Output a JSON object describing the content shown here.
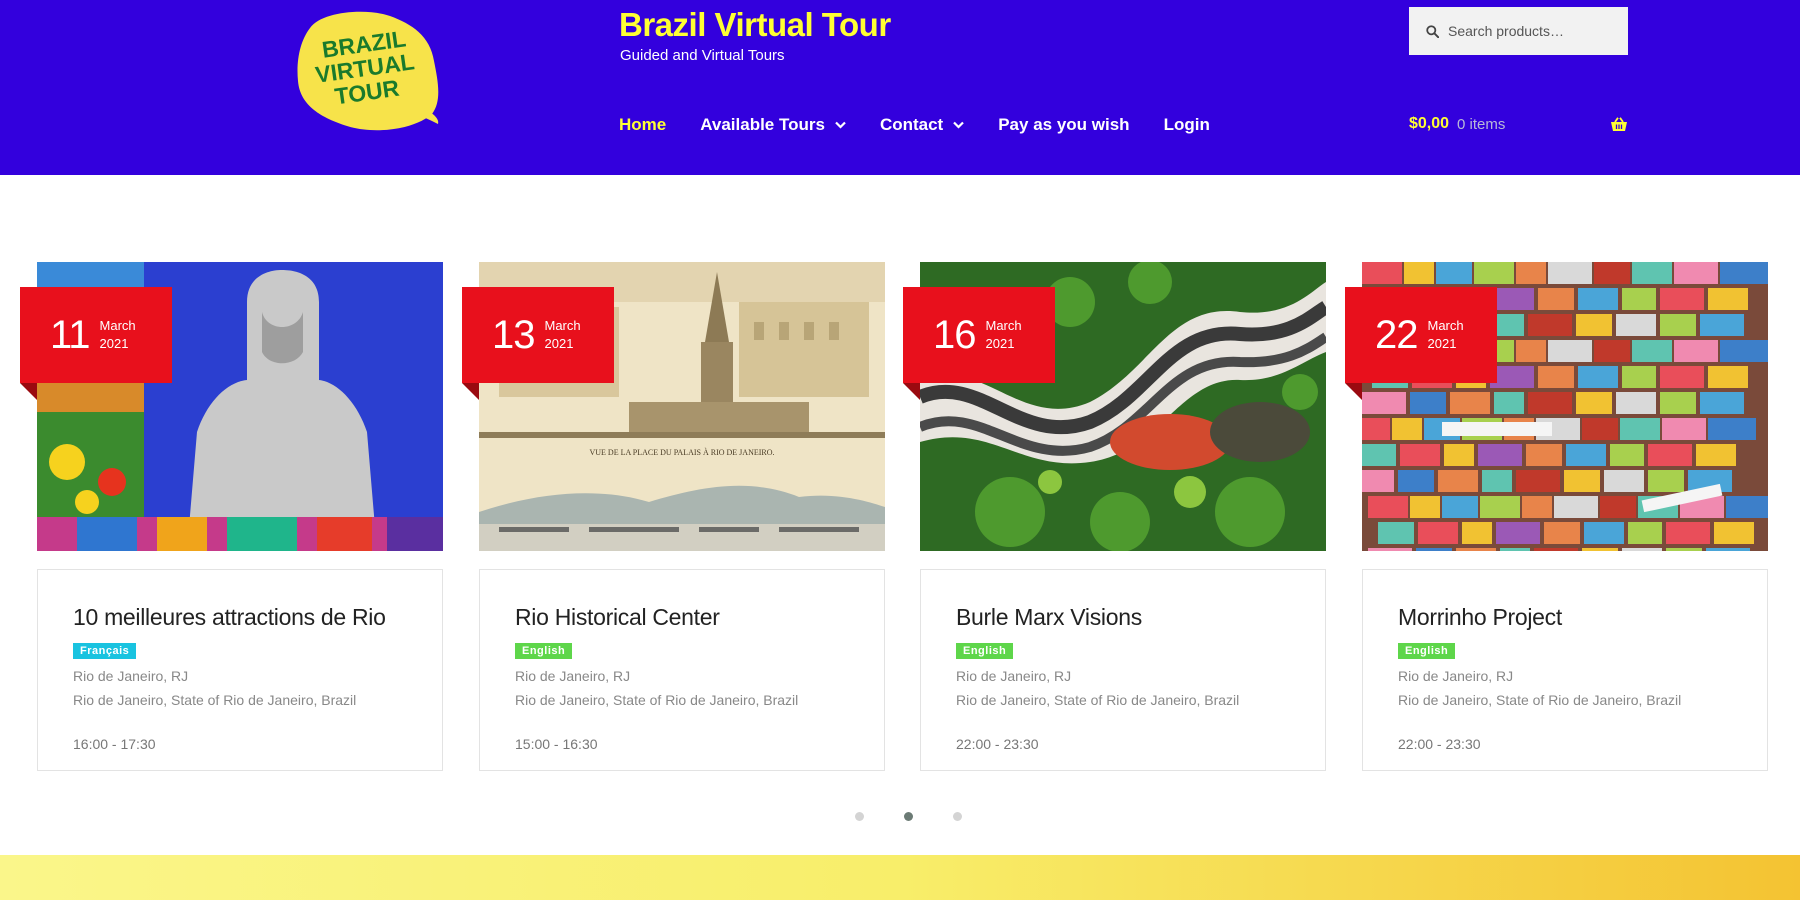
{
  "header": {
    "logo_text": "BRAZIL VIRTUAL TOUR",
    "site_title": "Brazil Virtual Tour",
    "site_description": "Guided and Virtual Tours",
    "search_placeholder": "Search products…",
    "nav": [
      {
        "label": "Home",
        "active": true
      },
      {
        "label": "Available Tours",
        "dropdown": true
      },
      {
        "label": "Contact",
        "dropdown": true
      },
      {
        "label": "Pay as you wish"
      },
      {
        "label": "Login"
      }
    ],
    "cart": {
      "amount": "$0,00",
      "count": "0 items"
    }
  },
  "colors": {
    "header_bg": "#3300dd",
    "accent_yellow": "#ffff33",
    "ribbon_red": "#e8101c",
    "badge_french": "#19c3e0",
    "badge_english": "#5ed64a"
  },
  "tours": [
    {
      "day": "11",
      "month": "March",
      "year": "2021",
      "title": "10 meilleures attractions de Rio",
      "language": "Français",
      "location": "Rio de Janeiro, RJ",
      "address": "Rio de Janeiro, State of Rio de Janeiro, Brazil",
      "time": "16:00 - 17:30"
    },
    {
      "day": "13",
      "month": "March",
      "year": "2021",
      "title": "Rio Historical Center",
      "language": "English",
      "location": "Rio de Janeiro, RJ",
      "address": "Rio de Janeiro, State of Rio de Janeiro, Brazil",
      "time": "15:00 - 16:30"
    },
    {
      "day": "16",
      "month": "March",
      "year": "2021",
      "title": "Burle Marx Visions",
      "language": "English",
      "location": "Rio de Janeiro, RJ",
      "address": "Rio de Janeiro, State of Rio de Janeiro, Brazil",
      "time": "22:00 - 23:30"
    },
    {
      "day": "22",
      "month": "March",
      "year": "2021",
      "title": "Morrinho Project",
      "language": "English",
      "location": "Rio de Janeiro, RJ",
      "address": "Rio de Janeiro, State of Rio de Janeiro, Brazil",
      "time": "22:00 - 23:30"
    }
  ],
  "carousel": {
    "pages": 3,
    "active_page": 2
  }
}
